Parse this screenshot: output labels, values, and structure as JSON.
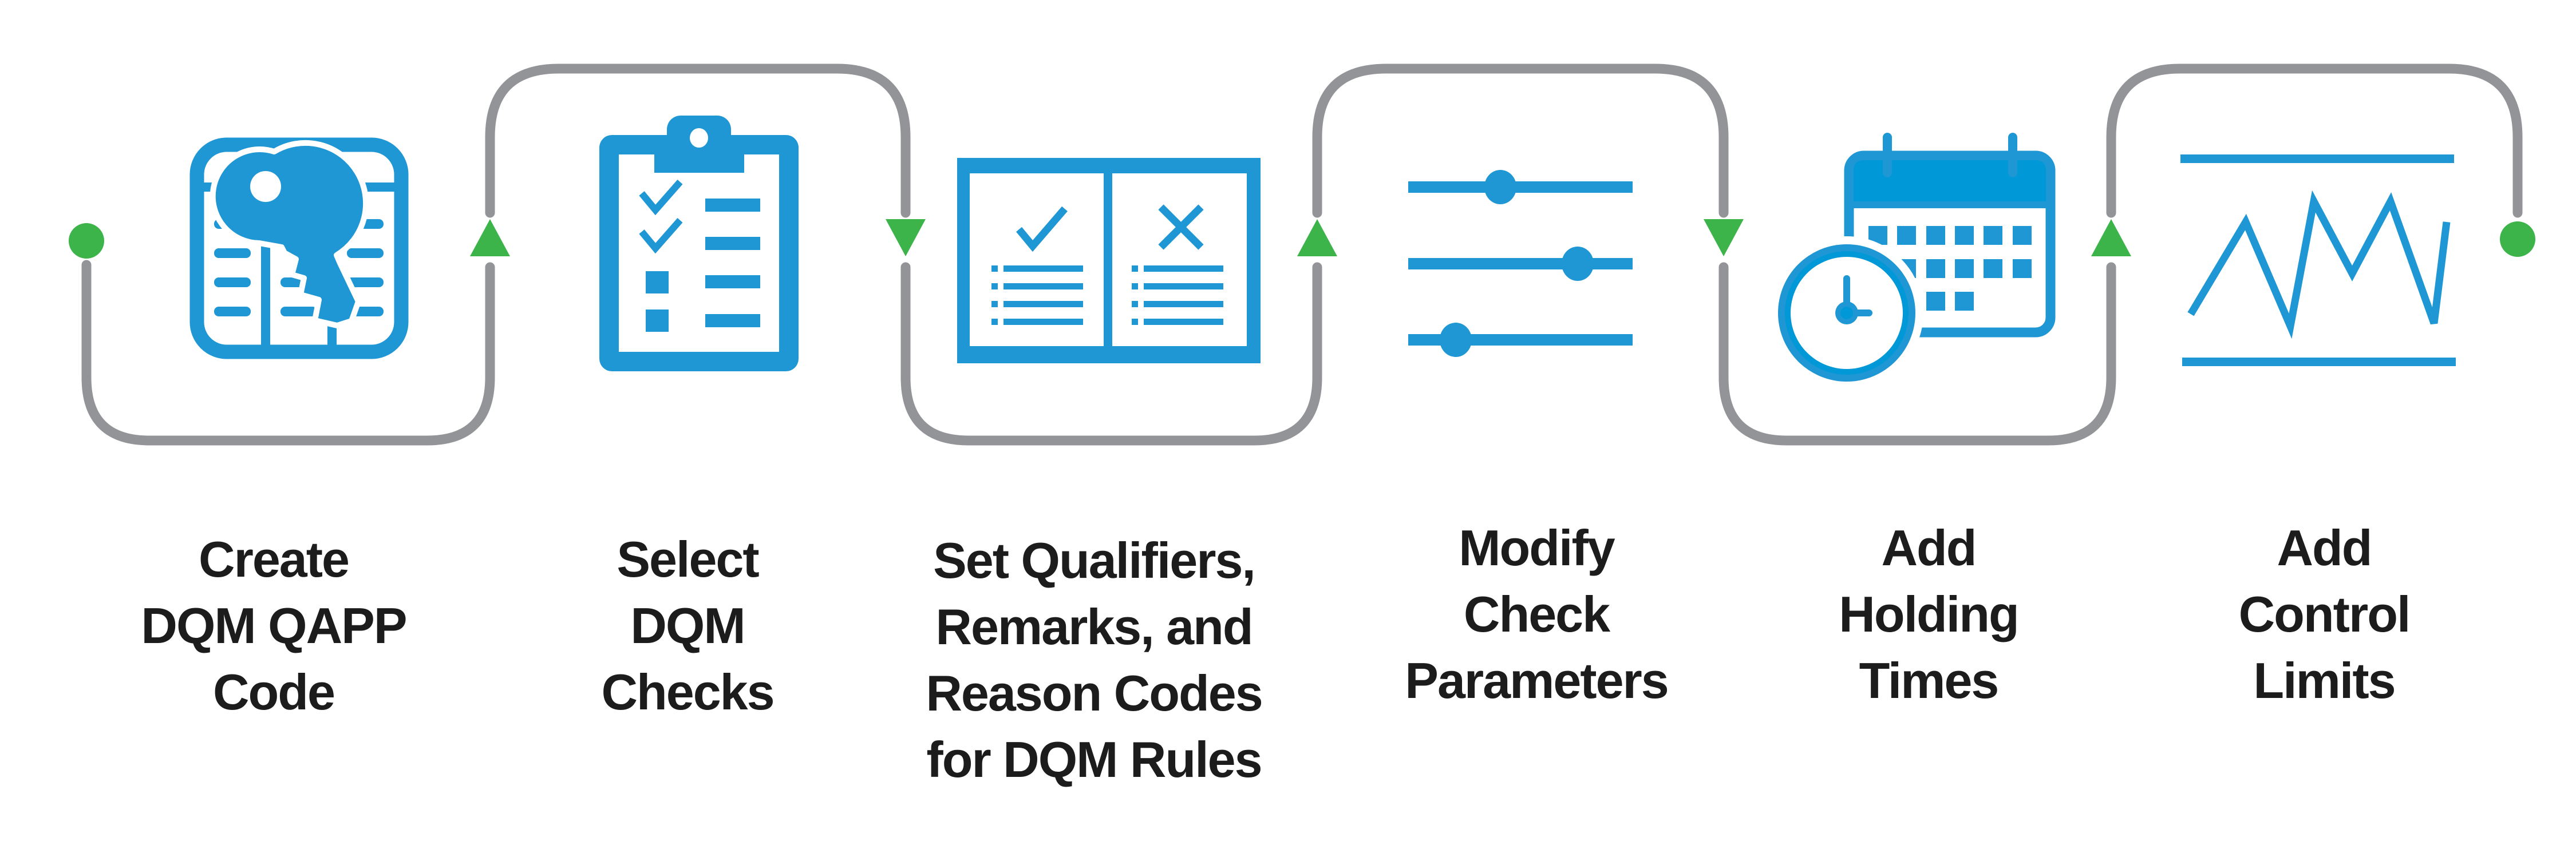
{
  "diagram": {
    "type": "process-flow",
    "colors": {
      "icon_blue": "#1f97d5",
      "icon_blue_dark": "#0098d6",
      "connector_gray": "#929497",
      "marker_green": "#3cb44a",
      "text": "#1b1c1b"
    },
    "start_marker": "start-dot",
    "end_marker": "end-dot",
    "steps": [
      {
        "id": 1,
        "icon": "database-table-key-icon",
        "label_lines": [
          "Create",
          "DQM QAPP",
          "Code"
        ],
        "arrow_after": "up"
      },
      {
        "id": 2,
        "icon": "clipboard-checklist-icon",
        "label_lines": [
          "Select",
          "DQM",
          "Checks"
        ],
        "arrow_after": "down"
      },
      {
        "id": 3,
        "icon": "accept-reject-panels-icon",
        "label_lines": [
          "Set Qualifiers,",
          "Remarks, and",
          "Reason Codes",
          "for DQM Rules"
        ],
        "arrow_after": "up"
      },
      {
        "id": 4,
        "icon": "sliders-icon",
        "label_lines": [
          "Modify",
          "Check",
          "Parameters"
        ],
        "arrow_after": "down"
      },
      {
        "id": 5,
        "icon": "calendar-clock-icon",
        "label_lines": [
          "Add",
          "Holding",
          "Times"
        ],
        "arrow_after": "up"
      },
      {
        "id": 6,
        "icon": "control-chart-icon",
        "label_lines": [
          "Add",
          "Control",
          "Limits"
        ],
        "arrow_after": null
      }
    ]
  }
}
